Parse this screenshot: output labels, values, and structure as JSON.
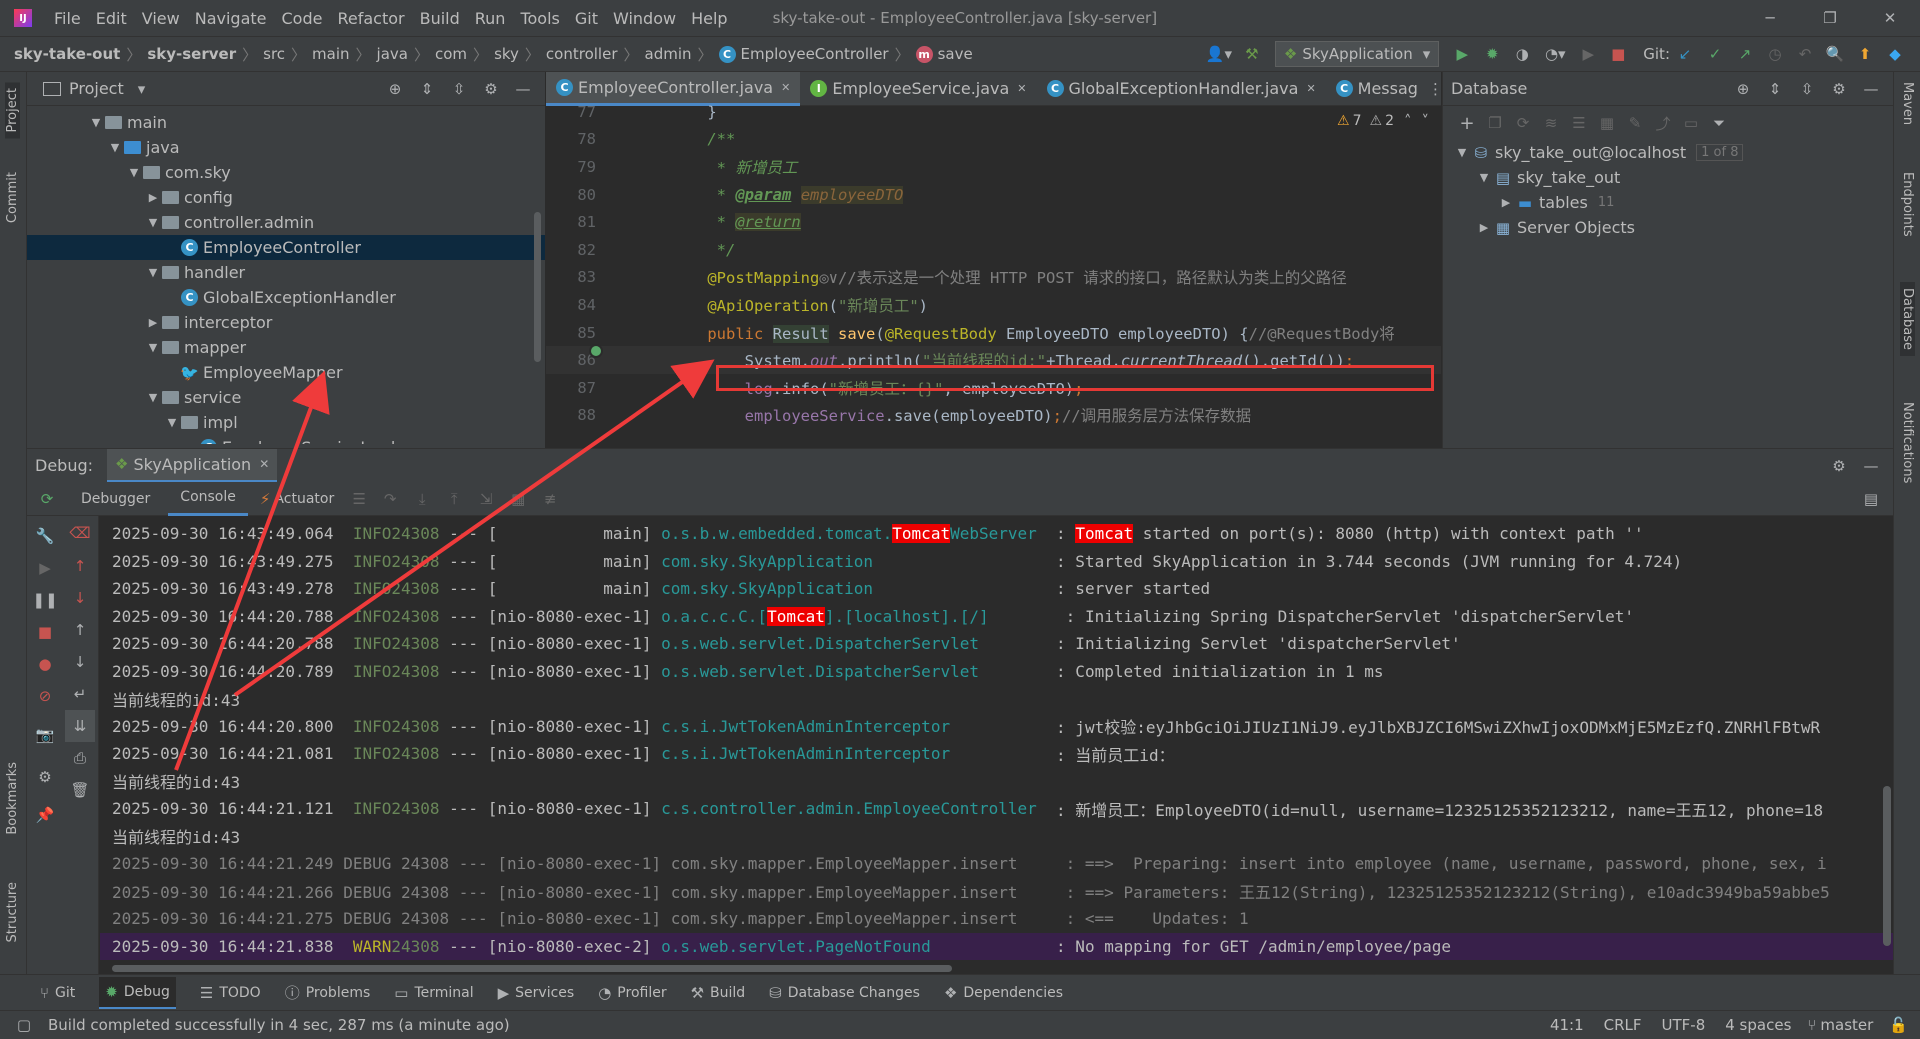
{
  "menu": [
    "File",
    "Edit",
    "View",
    "Navigate",
    "Code",
    "Refactor",
    "Build",
    "Run",
    "Tools",
    "Git",
    "Window",
    "Help"
  ],
  "window_title": "sky-take-out - EmployeeController.java [sky-server]",
  "breadcrumb": [
    "sky-take-out",
    "sky-server",
    "src",
    "main",
    "java",
    "com",
    "sky",
    "controller",
    "admin",
    "EmployeeController",
    "save"
  ],
  "run_config": "SkyApplication",
  "git_label": "Git:",
  "project_panel": {
    "title": "Project",
    "tree": [
      {
        "label": "main",
        "indent": 0,
        "type": "folder"
      },
      {
        "label": "java",
        "indent": 1,
        "type": "folder-blue"
      },
      {
        "label": "com.sky",
        "indent": 2,
        "type": "folder"
      },
      {
        "label": "config",
        "indent": 3,
        "type": "folder"
      },
      {
        "label": "controller.admin",
        "indent": 3,
        "type": "folder"
      },
      {
        "label": "EmployeeController",
        "indent": 4,
        "type": "class",
        "selected": true
      },
      {
        "label": "handler",
        "indent": 3,
        "type": "folder"
      },
      {
        "label": "GlobalExceptionHandler",
        "indent": 4,
        "type": "class"
      },
      {
        "label": "interceptor",
        "indent": 3,
        "type": "folder"
      },
      {
        "label": "mapper",
        "indent": 3,
        "type": "folder"
      },
      {
        "label": "EmployeeMapper",
        "indent": 4,
        "type": "mapper"
      },
      {
        "label": "service",
        "indent": 3,
        "type": "folder"
      },
      {
        "label": "impl",
        "indent": 4,
        "type": "folder"
      },
      {
        "label": "EmployeeServiceImpl",
        "indent": 5,
        "type": "class"
      }
    ]
  },
  "editor_tabs": [
    {
      "label": "EmployeeController.java",
      "active": true,
      "icon": "C"
    },
    {
      "label": "EmployeeService.java",
      "active": false,
      "icon": "I"
    },
    {
      "label": "GlobalExceptionHandler.java",
      "active": false,
      "icon": "C"
    },
    {
      "label": "Messag",
      "active": false,
      "icon": "C"
    }
  ],
  "inspections": {
    "warnings": "7",
    "weak": "2"
  },
  "code_lines": [
    {
      "num": "77",
      "html": "    }"
    },
    {
      "num": "78",
      "html": "    <span style='color:#629755;font-style:italic'>/**</span>"
    },
    {
      "num": "79",
      "html": "     <span style='color:#629755;font-style:italic'>* 新增员工</span>"
    },
    {
      "num": "80",
      "html": "     <span style='color:#629755;font-style:italic'>* <b style='text-decoration:underline'>@param</b> </span><span style='color:#8a653b;background:#3b3b2b;font-style:italic'>employeeDTO</span>"
    },
    {
      "num": "81",
      "html": "     <span style='color:#629755;font-style:italic'>* </span><span style='color:#629755;font-style:italic;background:#3b3b2b;text-decoration:underline'>@return</span>"
    },
    {
      "num": "82",
      "html": "     <span style='color:#629755;font-style:italic'>*/</span>"
    },
    {
      "num": "83",
      "html": "    <span style='color:#bbb529'>@PostMapping</span><span style='color:#808080'>◎∨//表示这是一个处理 HTTP POST 请求的接口，路径默认为类上的父路径</span>"
    },
    {
      "num": "84",
      "html": "    <span style='color:#bbb529'>@ApiOperation</span>(<span style='color:#6a8759'>\"新增员工\"</span>)"
    },
    {
      "num": "85",
      "html": "    <span style='color:#cc7832'>public</span> <span style='background:#344134'>Result</span> <span style='color:#ffc66d'>save</span>(<span style='color:#bbb529'>@RequestBody</span> EmployeeDTO employeeDTO) {<span style='color:#808080'>//@RequestBody将</span>"
    },
    {
      "num": "86",
      "html": "        System.<span style='color:#9876aa;font-style:italic'>out</span>.println(<span style='color:#6a8759'>\"当前线程的id:\"</span>+Thread.<i>currentThread</i>().getId())<span style='color:#cc7832'>;</span>"
    },
    {
      "num": "87",
      "html": "        <span style='color:#9876aa'>log</span>.info(<span style='color:#6a8759'>\"新增员工：{}\"</span>, employeeDTO)<span style='color:#cc7832'>;</span>"
    },
    {
      "num": "88",
      "html": "        <span style='color:#9876aa'>employeeService</span>.save(employeeDTO)<span style='color:#cc7832'>;</span><span style='color:#808080'>//调用服务层方法保存数据</span>"
    }
  ],
  "database_panel": {
    "title": "Database",
    "tree": [
      {
        "label": "sky_take_out@localhost",
        "badge": "1 of 8",
        "indent": 0
      },
      {
        "label": "sky_take_out",
        "badge": "",
        "indent": 1
      },
      {
        "label": "tables",
        "badge": "11",
        "indent": 2
      },
      {
        "label": "Server Objects",
        "badge": "",
        "indent": 1
      }
    ]
  },
  "debug": {
    "label": "Debug:",
    "session": "SkyApplication",
    "tabs": [
      "Debugger",
      "Console",
      "Actuator"
    ],
    "active_tab": "Console"
  },
  "console_lines": [
    "<span>2025-09-30 16:43:49.064  </span><span class='info'>INFO</span> <span class='info'>24308</span> --- [           main] <span class='cls'>o.s.b.w.embedded.tomcat.</span><span class='hl'>Tomcat</span><span class='cls'>WebServer</span>  : <span class='hl'>Tomcat</span> started on port(s): 8080 (http) with context path ''",
    "<span>2025-09-30 16:43:49.275  </span><span class='info'>INFO</span> <span class='info'>24308</span> --- [           main] <span class='cls'>com.sky.SkyApplication                  </span> : Started SkyApplication in 3.744 seconds (JVM running for 4.724)",
    "<span>2025-09-30 16:43:49.278  </span><span class='info'>INFO</span> <span class='info'>24308</span> --- [           main] <span class='cls'>com.sky.SkyApplication                  </span> : server started",
    "<span>2025-09-30 16:44:20.788  </span><span class='info'>INFO</span> <span class='info'>24308</span> --- [nio-8080-exec-1] <span class='cls'>o.a.c.c.C.[</span><span class='hl'>Tomcat</span><span class='cls'>].[localhost].[/]       </span> : Initializing Spring DispatcherServlet 'dispatcherServlet'",
    "<span>2025-09-30 16:44:20.788  </span><span class='info'>INFO</span> <span class='info'>24308</span> --- [nio-8080-exec-1] <span class='cls'>o.s.web.servlet.DispatcherServlet       </span> : Initializing Servlet 'dispatcherServlet'",
    "<span>2025-09-30 16:44:20.789  </span><span class='info'>INFO</span> <span class='info'>24308</span> --- [nio-8080-exec-1] <span class='cls'>o.s.web.servlet.DispatcherServlet       </span> : Completed initialization in 1 ms",
    "当前线程的id:43",
    "<span>2025-09-30 16:44:20.800  </span><span class='info'>INFO</span> <span class='info'>24308</span> --- [nio-8080-exec-1] <span class='cls'>c.s.i.JwtTokenAdminInterceptor          </span> : jwt校验:eyJhbGciOiJIUzI1NiJ9.eyJlbXBJZCI6MSwiZXhwIjoxODMxMjE5MzEzfQ.ZNRHlFBtwR",
    "<span>2025-09-30 16:44:21.081  </span><span class='info'>INFO</span> <span class='info'>24308</span> --- [nio-8080-exec-1] <span class='cls'>c.s.i.JwtTokenAdminInterceptor          </span> : 当前员工id：",
    "当前线程的id:43",
    "<span>2025-09-30 16:44:21.121  </span><span class='info'>INFO</span> <span class='info'>24308</span> --- [nio-8080-exec-1] <span class='cls'>c.s.controller.admin.EmployeeController </span> : 新增员工：EmployeeDTO(id=null, username=12325125352123212, name=王五12, phone=18",
    "当前线程的id:43",
    "<span class='gray'>2025-09-30 16:44:21.249 DEBUG 24308 --- [nio-8080-exec-1] com.sky.mapper.EmployeeMapper.insert     : ==>  Preparing: insert into employee (name, username, password, phone, sex, i</span>",
    "<span class='gray'>2025-09-30 16:44:21.266 DEBUG 24308 --- [nio-8080-exec-1] com.sky.mapper.EmployeeMapper.insert     : ==> Parameters: 王五12(String), 12325125352123212(String), e10adc3949ba59abbe5</span>",
    "<span class='gray'>2025-09-30 16:44:21.275 DEBUG 24308 --- [nio-8080-exec-1] com.sky.mapper.EmployeeMapper.insert     : &lt;==    Updates: 1</span>",
    "<span>2025-09-30 16:44:21.838  </span><span style='color:#bbb529'>WARN</span> <span class='info'>24308</span> --- [nio-8080-exec-2] <span class='cls'>o.s.web.servlet.PageNotFound            </span> : No mapping for GET /admin/employee/page"
  ],
  "bottom_tools": [
    "Git",
    "Debug",
    "TODO",
    "Problems",
    "Terminal",
    "Services",
    "Profiler",
    "Build",
    "Database Changes",
    "Dependencies"
  ],
  "status": {
    "message": "Build completed successfully in 4 sec, 287 ms (a minute ago)",
    "position": "41:1",
    "line_sep": "CRLF",
    "encoding": "UTF-8",
    "indent": "4 spaces",
    "branch": "master"
  },
  "left_stripe": [
    "Project",
    "Commit",
    "Bookmarks",
    "Structure"
  ],
  "right_stripe": [
    "Maven",
    "Endpoints",
    "Database",
    "Notifications"
  ]
}
